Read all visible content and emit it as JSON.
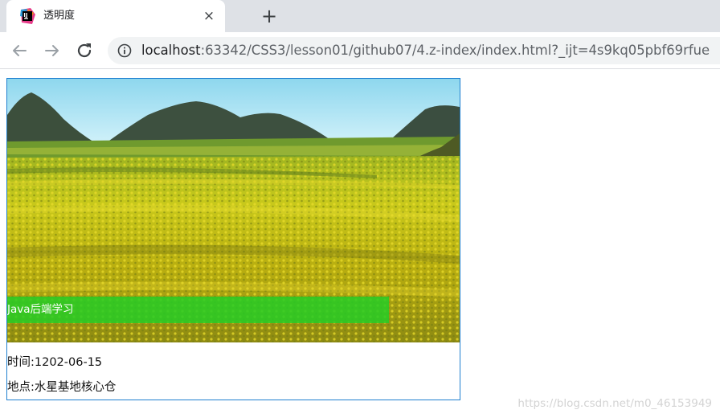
{
  "browser": {
    "tab": {
      "title": "透明度",
      "close": "×"
    },
    "new_tab": "+",
    "address": {
      "host": "localhost",
      "rest": ":63342/CSS3/lesson01/github07/4.z-index/index.html?_ijt=4s9kq05pbf69rfue"
    }
  },
  "page": {
    "caption": "Java后端学习",
    "time": "时间:1202-06-15",
    "place": "地点:水星基地核心仓"
  },
  "watermark": "https://blog.csdn.net/m0_46153949",
  "colors": {
    "caption_bg": "#24cd26",
    "card_border": "#1f7fd0"
  }
}
